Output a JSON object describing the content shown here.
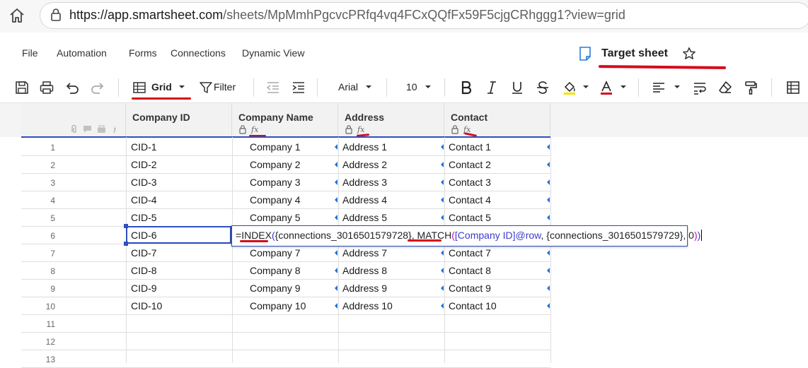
{
  "browser": {
    "url_host": "https://app.smartsheet.com",
    "url_path": "/sheets/MpMmhPgcvcPRfq4vq4FCxQQfFx59F5cjgCRhggg1?view=grid"
  },
  "menu": {
    "items": [
      "File",
      "Automation",
      "Forms",
      "Connections",
      "Dynamic View"
    ],
    "sheet_title": "Target sheet"
  },
  "toolbar": {
    "view_label": "Grid",
    "filter_label": "Filter",
    "font_name": "Arial",
    "font_size": "10"
  },
  "grid": {
    "columns": [
      "Company ID",
      "Company Name",
      "Address",
      "Contact"
    ],
    "row_numbers": [
      "1",
      "2",
      "3",
      "4",
      "5",
      "6",
      "7",
      "8",
      "9",
      "10",
      "11",
      "12",
      "13"
    ],
    "rows": [
      [
        "CID-1",
        "Company 1",
        "Address 1",
        "Contact 1"
      ],
      [
        "CID-2",
        "Company 2",
        "Address 2",
        "Contact 2"
      ],
      [
        "CID-3",
        "Company 3",
        "Address 3",
        "Contact 3"
      ],
      [
        "CID-4",
        "Company 4",
        "Address 4",
        "Contact 4"
      ],
      [
        "CID-5",
        "Company 5",
        "Address 5",
        "Contact 5"
      ],
      [
        "CID-6",
        "",
        "",
        ""
      ],
      [
        "CID-7",
        "Company 7",
        "Address 7",
        "Contact 7"
      ],
      [
        "CID-8",
        "Company 8",
        "Address 8",
        "Contact 8"
      ],
      [
        "CID-9",
        "Company 9",
        "Address 9",
        "Contact 9"
      ],
      [
        "CID-10",
        "Company 10",
        "Address 10",
        "Contact 10"
      ]
    ]
  },
  "formula": {
    "prefix": "=",
    "fn1": "INDEX",
    "open1": "(",
    "arg1": "{connections_3016501579728}",
    "comma1": ", ",
    "fn2": "MATCH",
    "open2": "(",
    "arg2": "[Company ID]@row",
    "comma2": ", ",
    "arg3": "{connections_3016501579729}",
    "comma3": ", 0",
    "close2": ")",
    "close1": ")"
  },
  "colors": {
    "annotation": "#d40c1c",
    "selection": "#2f4fbf",
    "marker": "#1e6fd9"
  }
}
